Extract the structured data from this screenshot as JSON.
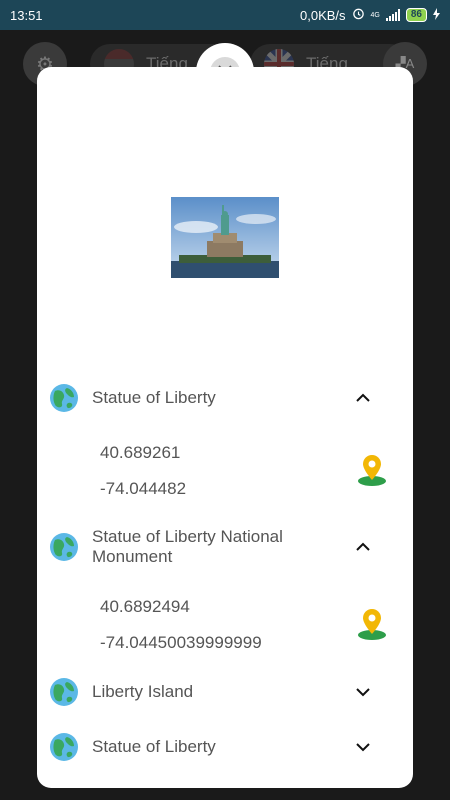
{
  "status_bar": {
    "time": "13:51",
    "network_speed": "0,0KB/s",
    "network_type": "4G",
    "battery": "86"
  },
  "background_app": {
    "source_lang": "Tiếng",
    "target_lang": "Tiếng",
    "settings_icon": "gear-icon",
    "tts_icon": "text-speech-icon"
  },
  "modal": {
    "close_icon": "close-icon",
    "results": [
      {
        "name": "Statue of Liberty",
        "lat": "40.689261",
        "lng": "-74.044482",
        "expanded": true
      },
      {
        "name": "Statue of Liberty National Monument",
        "lat": "40.6892494",
        "lng": "-74.04450039999999",
        "expanded": true
      },
      {
        "name": "Liberty Island",
        "expanded": false
      },
      {
        "name": "Statue of Liberty",
        "expanded": false
      }
    ]
  },
  "colors": {
    "status_bar": "#1d4657",
    "pin": "#f2b705",
    "pin_base": "#2e9e4a",
    "globe_land": "#3aa860",
    "globe_water": "#5bb8e6"
  }
}
